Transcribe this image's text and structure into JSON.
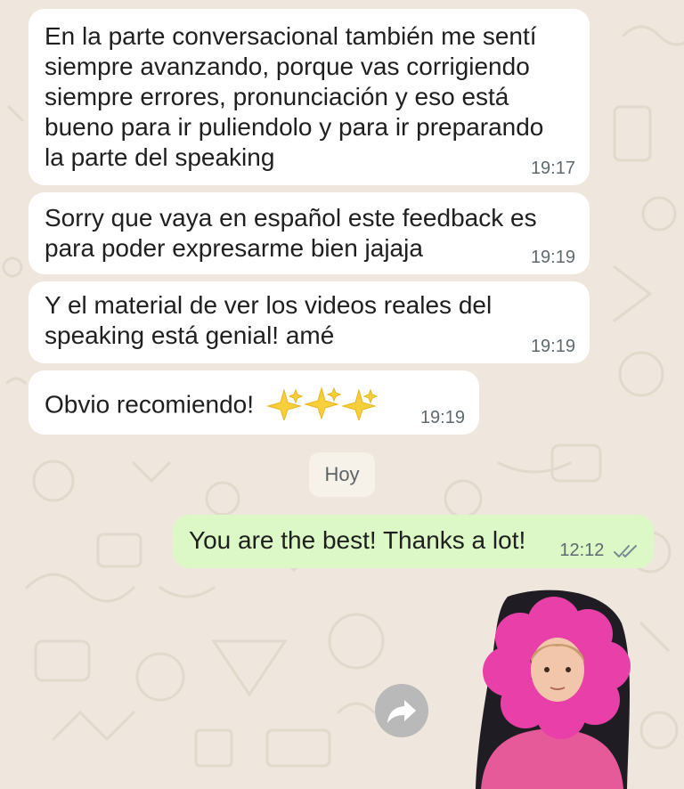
{
  "chat": {
    "messages": [
      {
        "text": "En la parte conversacional también me sentí\nsiempre avanzando, porque vas corrigiendo\nsiempre errores, pronunciación y eso está\nbueno para ir puliendolo y para ir preparando\nla parte del speaking",
        "time": "19:17"
      },
      {
        "text": "Sorry que vaya en español este feedback es\npara poder expresarme bien jajaja",
        "time": "19:19"
      },
      {
        "text": "Y el material de ver los videos reales del\nspeaking está genial! amé",
        "time": "19:19"
      },
      {
        "text": "Obvio recomiendo!",
        "emoji": "✨✨✨",
        "time": "19:19"
      }
    ],
    "day_divider": "Hoy",
    "outgoing": {
      "text": "You are the best! Thanks a lot!",
      "time": "12:12",
      "status": "read"
    }
  },
  "icons": {
    "forward": "forward-arrow-icon",
    "read_receipt": "double-check-icon",
    "sticker": "girl-flower-costume-sticker"
  },
  "colors": {
    "background": "#efe7dd",
    "incoming_bubble": "#ffffff",
    "outgoing_bubble": "#dcf8c6",
    "timestamp": "#5f6a70",
    "read_ticks": "#7a8b93"
  }
}
